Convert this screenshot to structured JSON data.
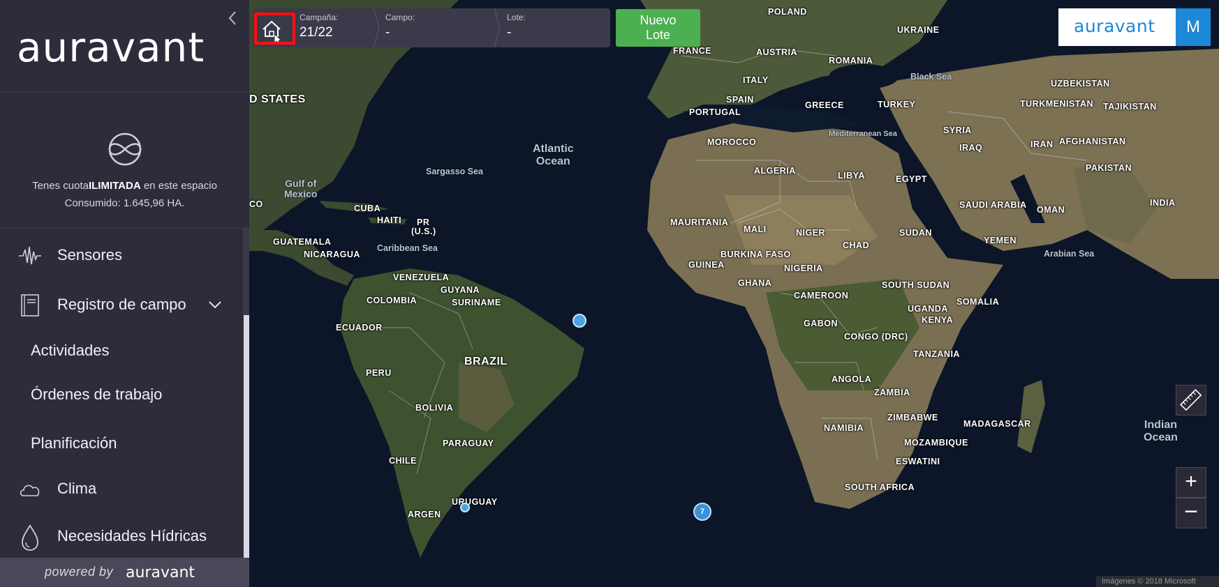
{
  "sidebar": {
    "brand": "auravant",
    "quota_prefix": "Tenes cuota",
    "quota_strong": "ILIMITADA",
    "quota_suffix": " en este espacio",
    "consumed": "Consumido: 1.645,96 HA.",
    "menu": {
      "sensores": "Sensores",
      "registro": "Registro de campo",
      "actividades": "Actividades",
      "ordenes": "Órdenes de trabajo",
      "planificacion": "Planificación",
      "clima": "Clima",
      "hidricas": "Necesidades Hídricas"
    },
    "footer_powered": "powered by",
    "footer_brand": "auravant"
  },
  "topbar": {
    "campana_label": "Campaña:",
    "campana_value": "21/22",
    "campo_label": "Campo:",
    "campo_value": "-",
    "lote_label": "Lote:",
    "lote_value": "-",
    "nuevo_line1": "Nuevo",
    "nuevo_line2": "Lote"
  },
  "user": {
    "initial": "M"
  },
  "map": {
    "cluster_count": "7",
    "copyright": "Imágenes © 2018 Microsoft",
    "countries": {
      "poland": "POLAND",
      "ukraine": "UKRAINE",
      "france": "FRANCE",
      "austria": "AUSTRIA",
      "romania": "ROMANIA",
      "italy": "ITALY",
      "spain": "SPAIN",
      "portugal": "PORTUGAL",
      "greece": "GREECE",
      "turkey": "TURKEY",
      "uzbekistan": "UZBEKISTAN",
      "turkmenistan": "TURKMENISTAN",
      "tajikistan": "TAJIKISTAN",
      "syria": "SYRIA",
      "iraq": "IRAQ",
      "iran": "IRAN",
      "afghanistan": "AFGHANISTAN",
      "pakistan": "PAKISTAN",
      "india": "INDIA",
      "morocco": "MOROCCO",
      "algeria": "ALGERIA",
      "libya": "LIBYA",
      "egypt": "EGYPT",
      "saudi": "SAUDI ARABIA",
      "oman": "OMAN",
      "yemen": "YEMEN",
      "mauritania": "MAURITANIA",
      "mali": "MALI",
      "niger": "NIGER",
      "sudan": "SUDAN",
      "chad": "CHAD",
      "burkina": "BURKINA FASO",
      "guinea": "GUINEA",
      "nigeria": "NIGERIA",
      "ghana": "GHANA",
      "southsudan": "SOUTH SUDAN",
      "cameroon": "CAMEROON",
      "somalia": "SOMALIA",
      "uganda": "UGANDA",
      "kenya": "KENYA",
      "gabon": "GABON",
      "congo": "CONGO (DRC)",
      "tanzania": "TANZANIA",
      "angola": "ANGOLA",
      "zambia": "ZAMBIA",
      "zimbabwe": "ZIMBABWE",
      "namibia": "NAMIBIA",
      "mozambique": "MOZAMBIQUE",
      "madagascar": "MADAGASCAR",
      "eswatini": "ESWATINI",
      "southafrica": "SOUTH AFRICA",
      "usa": "D STATES",
      "cuba": "CUBA",
      "haiti": "HAITI",
      "pr": "PR",
      "pr2": "(U.S.)",
      "guatemala": "GUATEMALA",
      "nicaragua": "NICARAGUA",
      "venezuela": "VENEZUELA",
      "guyana": "GUYANA",
      "suriname": "SURINAME",
      "colombia": "COLOMBIA",
      "ecuador": "ECUADOR",
      "brazil": "BRAZIL",
      "peru": "PERU",
      "bolivia": "BOLIVIA",
      "paraguay": "PARAGUAY",
      "chile": "CHILE",
      "uruguay": "URUGUAY",
      "argentina": "ARGEN",
      "mexico_co": "CO"
    },
    "seas": {
      "black": "Black Sea",
      "med": "Mediterranean Sea",
      "sargasso": "Sargasso Sea",
      "caribbean": "Caribbean Sea",
      "arabian": "Arabian Sea",
      "gulf1": "Gulf of",
      "gulf2": "Mexico",
      "atlantic1": "Atlantic",
      "atlantic2": "Ocean",
      "indian1": "Indian",
      "indian2": "Ocean"
    }
  }
}
